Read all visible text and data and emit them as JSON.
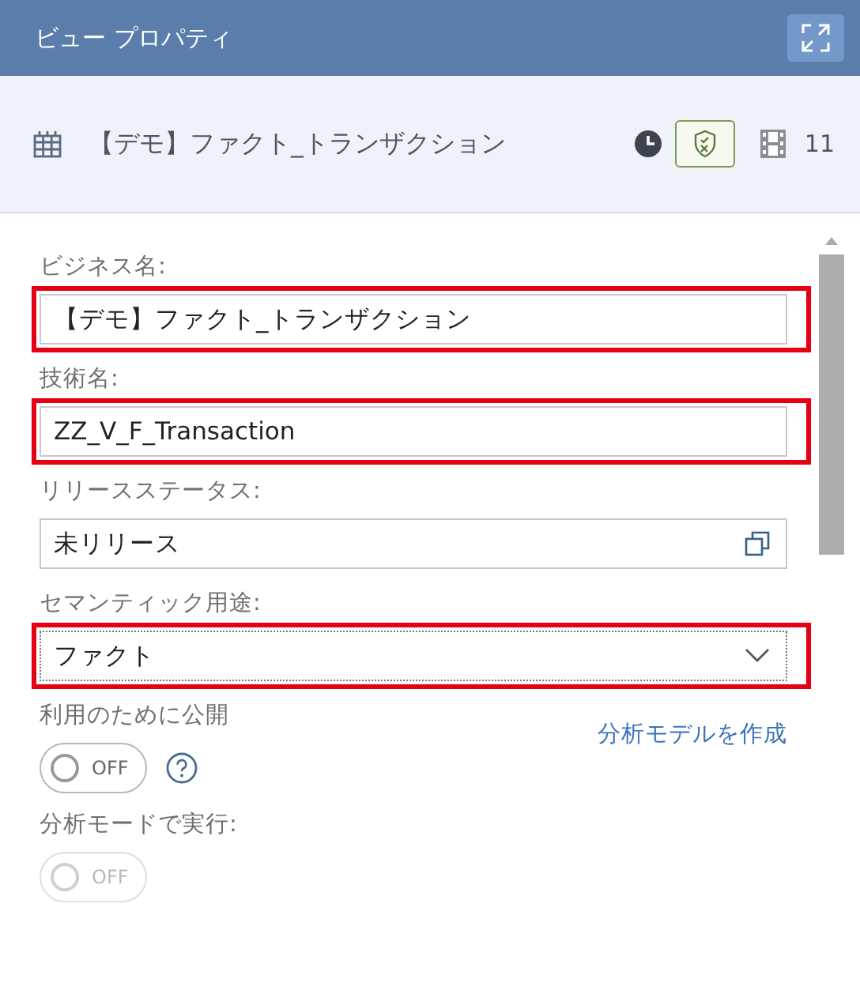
{
  "header": {
    "title": "ビュー プロパティ"
  },
  "summary": {
    "name": "【デモ】ファクト_トランザクション",
    "count": "11"
  },
  "fields": [
    {
      "kind": "text",
      "label": "ビジネス名:",
      "value": "【デモ】ファクト_トランザクション",
      "highlighted": true
    },
    {
      "kind": "text",
      "label": "技術名:",
      "value": "ZZ_V_F_Transaction",
      "highlighted": true
    },
    {
      "kind": "readonly",
      "label": "リリースステータス:",
      "value": "未リリース",
      "highlighted": false
    },
    {
      "kind": "select",
      "label": "セマンティック用途:",
      "value": "ファクト",
      "highlighted": true
    }
  ],
  "switches": [
    {
      "label": "利用のために公開",
      "link": "分析モデルを作成",
      "text": "OFF",
      "on": false,
      "disabled": false,
      "help": true
    },
    {
      "label": "分析モードで実行:",
      "text": "OFF",
      "on": false,
      "disabled": true,
      "help": false
    }
  ]
}
